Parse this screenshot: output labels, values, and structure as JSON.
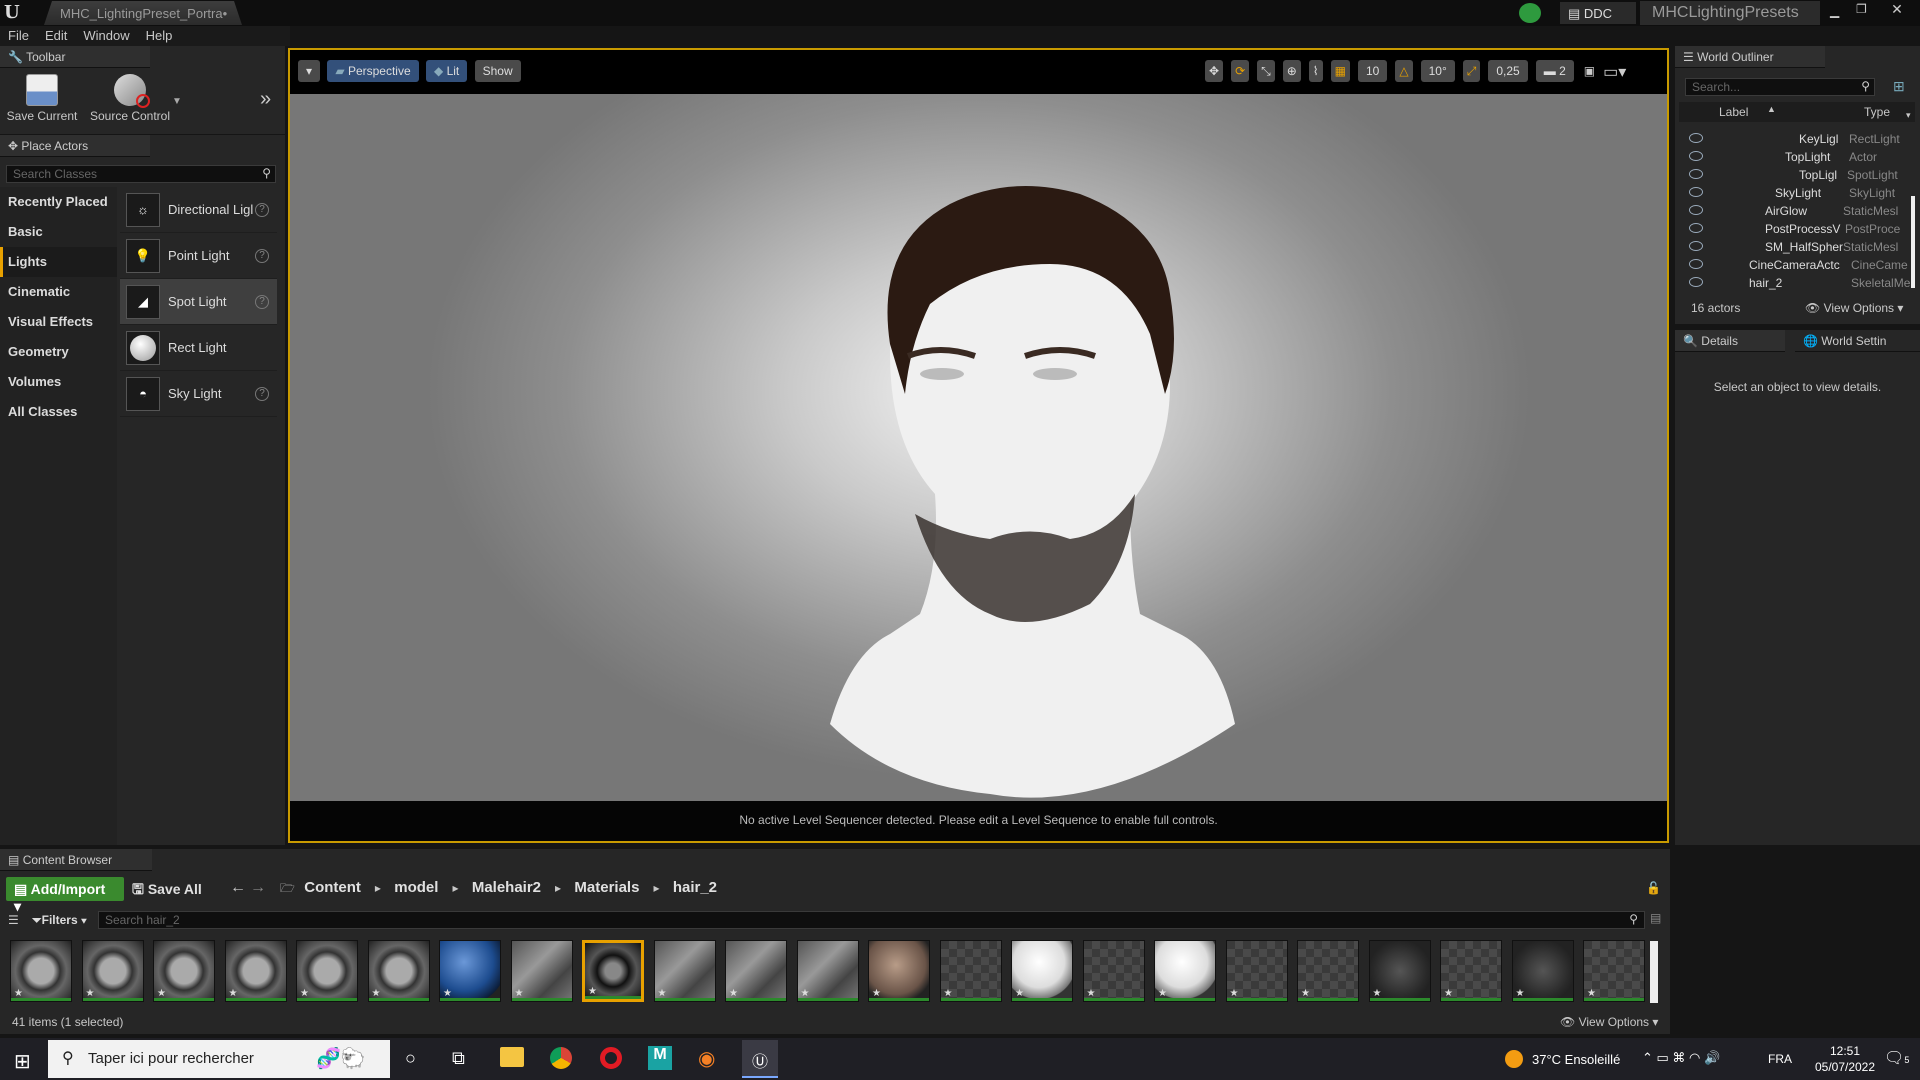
{
  "window": {
    "tab_title": "MHC_LightingPreset_Portra•",
    "ddc_label": "DDC",
    "project_name": "MHCLightingPresets"
  },
  "menu": [
    "File",
    "Edit",
    "Window",
    "Help"
  ],
  "toolbar": {
    "tab_label": "Toolbar",
    "save_current": "Save Current",
    "source_control": "Source Control"
  },
  "place_actors": {
    "tab_label": "Place Actors",
    "search_placeholder": "Search Classes",
    "categories": [
      "Recently Placed",
      "Basic",
      "Lights",
      "Cinematic",
      "Visual Effects",
      "Geometry",
      "Volumes",
      "All Classes"
    ],
    "active_category": "Lights",
    "items": [
      "Directional Ligl",
      "Point Light",
      "Spot Light",
      "Rect Light",
      "Sky Light"
    ]
  },
  "viewport": {
    "perspective": "Perspective",
    "lit": "Lit",
    "show": "Show",
    "grid_snap": "10",
    "rotation_snap": "10°",
    "scale_snap": "0,25",
    "camera_speed": "2",
    "sequencer_message": "No active Level Sequencer detected. Please edit a Level Sequence to enable full controls."
  },
  "world_outliner": {
    "tab_label": "World Outliner",
    "search_placeholder": "Search...",
    "col_label": "Label",
    "col_type": "Type",
    "rows": [
      {
        "label": "KeyLigl",
        "type": "RectLight",
        "indent": 3
      },
      {
        "label": "TopLight",
        "type": "Actor",
        "indent": 2
      },
      {
        "label": "TopLigl",
        "type": "SpotLight",
        "indent": 3
      },
      {
        "label": "SkyLight",
        "type": "SkyLight",
        "indent": 1
      },
      {
        "label": "AirGlow",
        "type": "StaticMesl",
        "indent": 1
      },
      {
        "label": "PostProcessV",
        "type": "PostProce",
        "indent": 1
      },
      {
        "label": "SM_HalfSpher",
        "type": "StaticMesl",
        "indent": 1
      },
      {
        "label": "CineCameraActc",
        "type": "CineCame",
        "indent": 0
      },
      {
        "label": "hair_2",
        "type": "SkeletalMe",
        "indent": 0
      }
    ],
    "actor_count": "16 actors",
    "view_options": "View Options"
  },
  "details": {
    "tab_label": "Details",
    "world_settings_tab": "World Settin",
    "empty_message": "Select an object to view details."
  },
  "content_browser": {
    "tab_label": "Content Browser",
    "add_import": "Add/Import",
    "save_all": "Save All",
    "breadcrumb": [
      "Content",
      "model",
      "Malehair2",
      "Materials",
      "hair_2"
    ],
    "filters": "Filters",
    "search_placeholder": "Search hair_2",
    "status": "41 items (1 selected)",
    "view_options": "View Options",
    "thumbnails": [
      "hairball",
      "hairball",
      "hairball",
      "hairball",
      "hairball",
      "hairball",
      "blue",
      "wisp",
      "selected",
      "wisp",
      "wisp",
      "wisp",
      "skin",
      "checker",
      "white",
      "checker",
      "white",
      "checker",
      "checker",
      "dark",
      "checker",
      "dark",
      "checker"
    ]
  },
  "taskbar": {
    "search_placeholder": "Taper ici pour rechercher",
    "weather": "37°C Ensoleillé",
    "language": "FRA",
    "time": "12:51",
    "date": "05/07/2022",
    "notification_count": "5"
  },
  "colors": {
    "accent_orange": "#e8a100",
    "add_import_green": "#3a8a2e",
    "selection_blue": "#33507a"
  }
}
